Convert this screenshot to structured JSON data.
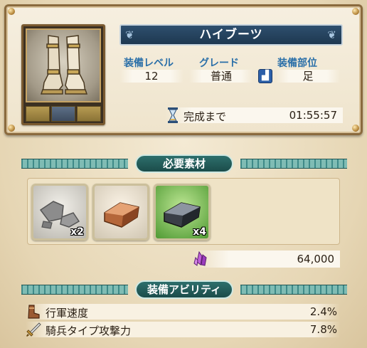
{
  "equipment": {
    "name": "ハイブーツ",
    "stats": [
      {
        "label": "装備レベル",
        "value": "12"
      },
      {
        "label": "グレード",
        "value": "普通"
      },
      {
        "label": "装備部位",
        "value": "足"
      }
    ],
    "timer_label": "完成まで",
    "timer_value": "01:55:57"
  },
  "materials_section": {
    "title": "必要素材",
    "items": [
      {
        "icon": "stone-icon",
        "qty": "x2"
      },
      {
        "icon": "copper-ingot-icon",
        "qty": ""
      },
      {
        "icon": "iron-ingot-icon",
        "qty": "x4"
      }
    ],
    "cost": "64,000"
  },
  "abilities_section": {
    "title": "装備アビリティ",
    "items": [
      {
        "icon": "boot-icon",
        "name": "行軍速度",
        "value": "2.4%"
      },
      {
        "icon": "sword-icon",
        "name": "騎兵タイプ攻撃力",
        "value": "7.8%"
      }
    ]
  }
}
